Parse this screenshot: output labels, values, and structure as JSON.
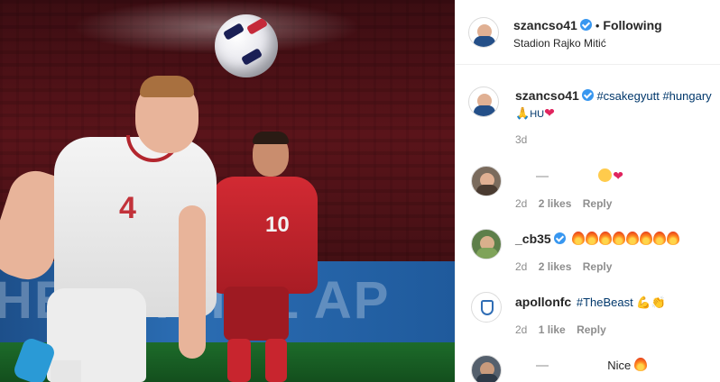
{
  "post": {
    "username": "szancso41",
    "follow_state": "Following",
    "location": "Stadion Rajko Mitić",
    "caption_tags": "#csakegyutt #hungary",
    "caption_tail": "HU",
    "caption_age": "3d"
  },
  "photo": {
    "board_text": "HE FFICIAL AP"
  },
  "comments": [
    {
      "username": "",
      "text": "",
      "age": "2d",
      "likes": "2 likes",
      "reply": "Reply"
    },
    {
      "username": "_cb35",
      "text": "",
      "age": "2d",
      "likes": "2 likes",
      "reply": "Reply"
    },
    {
      "username": "apollonfc",
      "text": "#TheBeast",
      "age": "2d",
      "likes": "1 like",
      "reply": "Reply"
    },
    {
      "username": "",
      "text": "Nice",
      "age": "",
      "likes": "",
      "reply": ""
    }
  ],
  "kit_numbers": {
    "player_white": "4",
    "player_red": "10"
  },
  "colors": {
    "verified": "#3897f0",
    "hashtag": "#00376b",
    "meta": "#8e8e8e"
  }
}
